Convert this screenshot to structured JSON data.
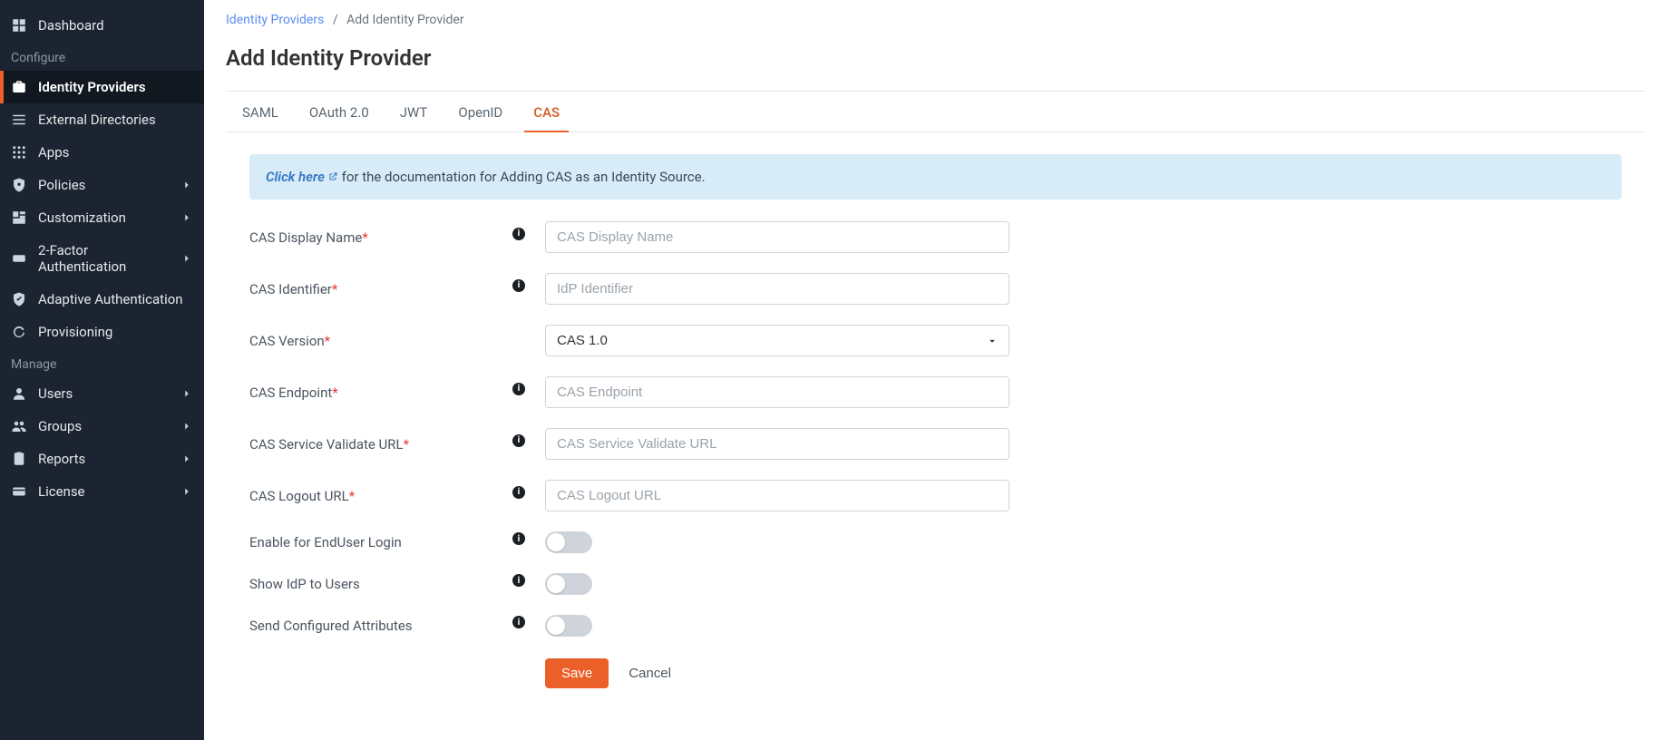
{
  "sidebar": {
    "items": [
      {
        "label": "Dashboard",
        "icon": "dashboard"
      },
      {
        "section": "Configure"
      },
      {
        "label": "Identity Providers",
        "icon": "briefcase",
        "active": true
      },
      {
        "label": "External Directories",
        "icon": "list"
      },
      {
        "label": "Apps",
        "icon": "apps"
      },
      {
        "label": "Policies",
        "icon": "shield-cog",
        "chev": true
      },
      {
        "label": "Customization",
        "icon": "customize",
        "chev": true
      },
      {
        "label": "2-Factor Authentication",
        "icon": "otp",
        "chev": true
      },
      {
        "label": "Adaptive Authentication",
        "icon": "shield-check"
      },
      {
        "label": "Provisioning",
        "icon": "sync"
      },
      {
        "section": "Manage"
      },
      {
        "label": "Users",
        "icon": "user",
        "chev": true
      },
      {
        "label": "Groups",
        "icon": "groups",
        "chev": true
      },
      {
        "label": "Reports",
        "icon": "clipboard",
        "chev": true
      },
      {
        "label": "License",
        "icon": "card",
        "chev": true
      }
    ]
  },
  "breadcrumb": {
    "parent": "Identity Providers",
    "sep": "/",
    "current": "Add Identity Provider"
  },
  "page_title": "Add Identity Provider",
  "tabs": [
    {
      "label": "SAML"
    },
    {
      "label": "OAuth 2.0"
    },
    {
      "label": "JWT"
    },
    {
      "label": "OpenID"
    },
    {
      "label": "CAS",
      "active": true
    }
  ],
  "info": {
    "click_here": "Click here",
    "tail": " for the documentation for Adding CAS as an Identity Source."
  },
  "form": {
    "display_name": {
      "label": "CAS Display Name",
      "required": true,
      "placeholder": "CAS Display Name"
    },
    "identifier": {
      "label": "CAS Identifier",
      "required": true,
      "placeholder": "IdP Identifier"
    },
    "version": {
      "label": "CAS Version",
      "required": true,
      "value": "CAS 1.0"
    },
    "endpoint": {
      "label": "CAS Endpoint",
      "required": true,
      "placeholder": "CAS Endpoint"
    },
    "validate_url": {
      "label": "CAS Service Validate URL",
      "required": true,
      "placeholder": "CAS Service Validate URL"
    },
    "logout_url": {
      "label": "CAS Logout URL",
      "required": true,
      "placeholder": "CAS Logout URL"
    },
    "enduser_login": {
      "label": "Enable for EndUser Login"
    },
    "show_idp": {
      "label": "Show IdP to Users"
    },
    "send_attrs": {
      "label": "Send Configured Attributes"
    }
  },
  "actions": {
    "save": "Save",
    "cancel": "Cancel"
  }
}
